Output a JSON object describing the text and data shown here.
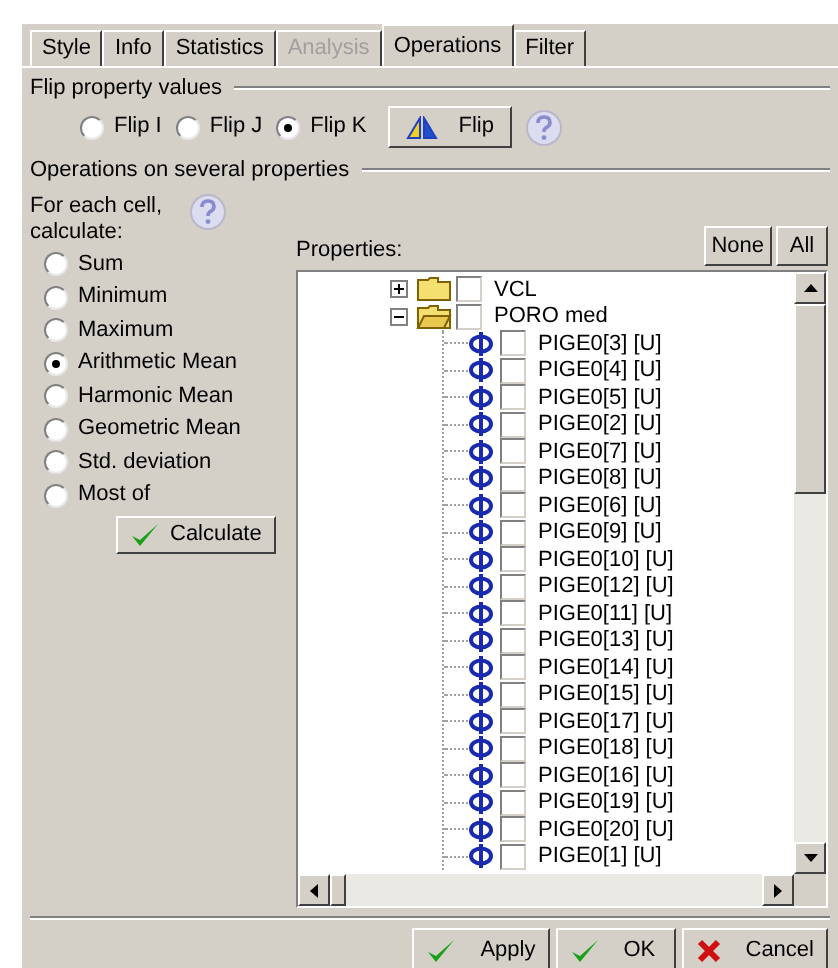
{
  "tabs": [
    {
      "label": "Style",
      "selected": false,
      "disabled": false
    },
    {
      "label": "Info",
      "selected": false,
      "disabled": false
    },
    {
      "label": "Statistics",
      "selected": false,
      "disabled": false
    },
    {
      "label": "Analysis",
      "selected": false,
      "disabled": true
    },
    {
      "label": "Operations",
      "selected": true,
      "disabled": false
    },
    {
      "label": "Filter",
      "selected": false,
      "disabled": false
    }
  ],
  "flip": {
    "title": "Flip property values",
    "options": [
      {
        "label": "Flip I",
        "selected": false
      },
      {
        "label": "Flip J",
        "selected": false
      },
      {
        "label": "Flip K",
        "selected": true
      }
    ],
    "button": "Flip"
  },
  "operations": {
    "title": "Operations on several properties",
    "prompt": "For each cell, calculate:",
    "options": [
      {
        "label": "Sum",
        "selected": false
      },
      {
        "label": "Minimum",
        "selected": false
      },
      {
        "label": "Maximum",
        "selected": false
      },
      {
        "label": "Arithmetic Mean",
        "selected": true
      },
      {
        "label": "Harmonic Mean",
        "selected": false
      },
      {
        "label": "Geometric Mean",
        "selected": false
      },
      {
        "label": "Std. deviation",
        "selected": false
      },
      {
        "label": "Most of",
        "selected": false
      }
    ],
    "calculate_button": "Calculate",
    "properties_label": "Properties:",
    "none_button": "None",
    "all_button": "All",
    "tree": [
      {
        "kind": "folder",
        "label": "VCL",
        "expanded": false,
        "checked": false
      },
      {
        "kind": "folder",
        "label": "PORO med",
        "expanded": true,
        "checked": false,
        "children": [
          {
            "kind": "property",
            "label": "PIGE0[3] [U]",
            "checked": false
          },
          {
            "kind": "property",
            "label": "PIGE0[4] [U]",
            "checked": false
          },
          {
            "kind": "property",
            "label": "PIGE0[5] [U]",
            "checked": false
          },
          {
            "kind": "property",
            "label": "PIGE0[2] [U]",
            "checked": false
          },
          {
            "kind": "property",
            "label": "PIGE0[7] [U]",
            "checked": false
          },
          {
            "kind": "property",
            "label": "PIGE0[8] [U]",
            "checked": false
          },
          {
            "kind": "property",
            "label": "PIGE0[6] [U]",
            "checked": false
          },
          {
            "kind": "property",
            "label": "PIGE0[9] [U]",
            "checked": false
          },
          {
            "kind": "property",
            "label": "PIGE0[10] [U]",
            "checked": false
          },
          {
            "kind": "property",
            "label": "PIGE0[12] [U]",
            "checked": false
          },
          {
            "kind": "property",
            "label": "PIGE0[11] [U]",
            "checked": false
          },
          {
            "kind": "property",
            "label": "PIGE0[13] [U]",
            "checked": false
          },
          {
            "kind": "property",
            "label": "PIGE0[14] [U]",
            "checked": false
          },
          {
            "kind": "property",
            "label": "PIGE0[15] [U]",
            "checked": false
          },
          {
            "kind": "property",
            "label": "PIGE0[17] [U]",
            "checked": false
          },
          {
            "kind": "property",
            "label": "PIGE0[18] [U]",
            "checked": false
          },
          {
            "kind": "property",
            "label": "PIGE0[16] [U]",
            "checked": false
          },
          {
            "kind": "property",
            "label": "PIGE0[19] [U]",
            "checked": false
          },
          {
            "kind": "property",
            "label": "PIGE0[20] [U]",
            "checked": false
          },
          {
            "kind": "property",
            "label": "PIGE0[1] [U]",
            "checked": false
          }
        ]
      }
    ]
  },
  "buttons": [
    {
      "kind": "apply",
      "label": "Apply"
    },
    {
      "kind": "ok",
      "label": "OK"
    },
    {
      "kind": "cancel",
      "label": "Cancel"
    }
  ]
}
